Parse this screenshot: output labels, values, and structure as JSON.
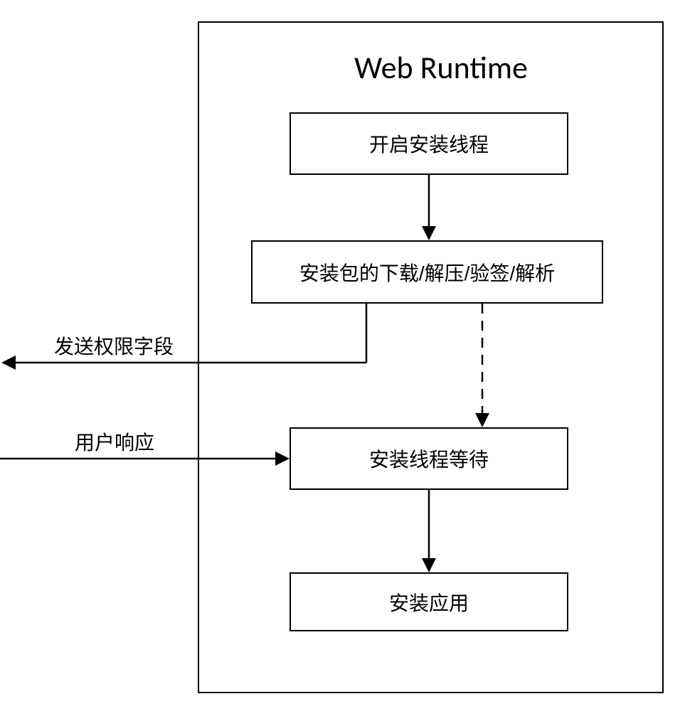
{
  "container": {
    "title": "Web Runtime"
  },
  "nodes": {
    "n1": "开启安装线程",
    "n2": "安装包的下载/解压/验签/解析",
    "n3": "安装线程等待",
    "n4": "安装应用"
  },
  "labels": {
    "out1": "发送权限字段",
    "in1": "用户响应"
  }
}
